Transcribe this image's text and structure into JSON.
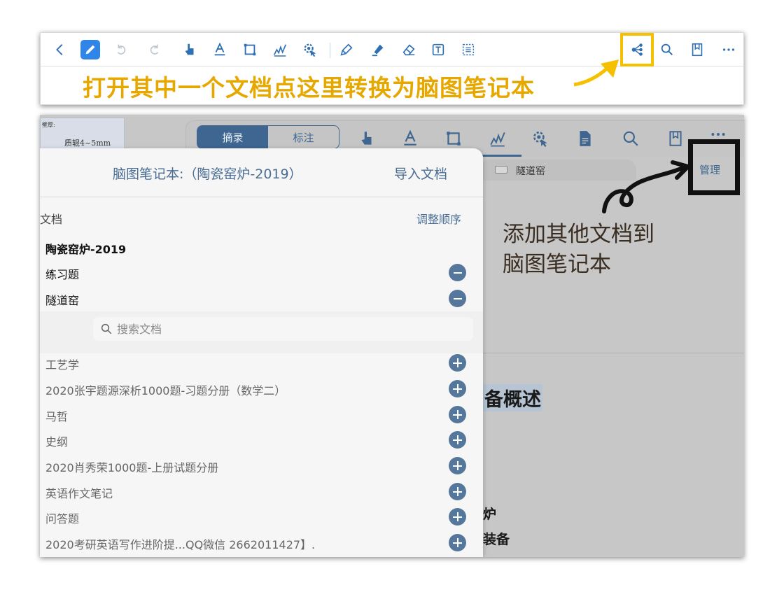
{
  "top_toolbar": {
    "icons": [
      "back-icon",
      "pencil-icon",
      "undo-icon",
      "redo-icon",
      "hand-pointer-icon",
      "text-underline-icon",
      "rectangle-select-icon",
      "signature-icon",
      "cursor-settings-icon",
      "pen-icon",
      "highlighter-icon",
      "eraser-icon",
      "text-box-icon",
      "lasso-icon",
      "mind-map-icon",
      "search-icon",
      "bookmark-icon",
      "more-icon"
    ],
    "annotation": "打开其中一个文档点这里转换为脑图笔记本",
    "highlight_color": "#f5c000",
    "accent_color": "#2f86e8"
  },
  "app": {
    "thumbnail": {
      "header": "壁厚:",
      "text": "质辊4~5mm"
    },
    "segmented": {
      "excerpt": "摘录",
      "annotate": "标注"
    },
    "tab": {
      "label": "隧道窑"
    },
    "manage_label": "管理",
    "annotation": [
      "添加其他文档到",
      "脑图笔记本"
    ],
    "background_text": {
      "heading": "备概述",
      "line1": "炉",
      "line2": "装备"
    },
    "accent_color": "#3e6690"
  },
  "popover": {
    "title": "脑图笔记本:（陶瓷窑炉-2019）",
    "import_label": "导入文档",
    "section_label": "文档",
    "reorder_label": "调整顺序",
    "current_docs": [
      "陶瓷窑炉-2019",
      "练习题",
      "隧道窑"
    ],
    "search_placeholder": "搜索文档",
    "available_docs": [
      "工艺学",
      "2020张宇题源深析1000题-习题分册（数学二）",
      "马哲",
      "史纲",
      "2020肖秀荣1000题-上册试题分册",
      "英语作文笔记",
      "问答题",
      "2020考研英语写作进阶提...QQ微信  2662011427】."
    ]
  }
}
